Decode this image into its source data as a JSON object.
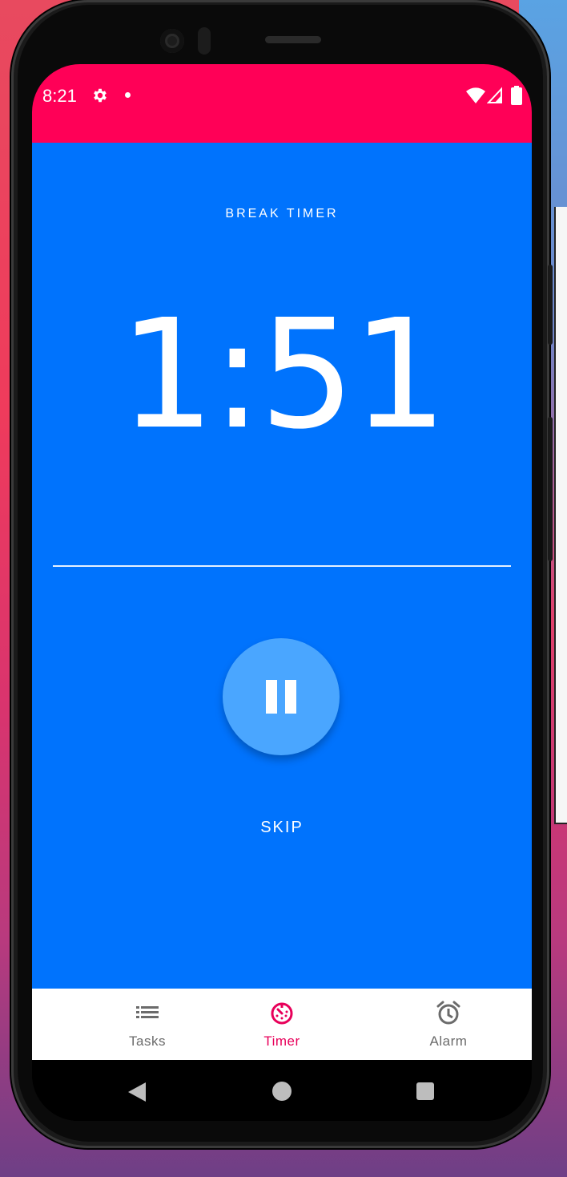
{
  "status_bar": {
    "time": "8:21",
    "icons": [
      "gear-icon",
      "notification-dot-icon",
      "wifi-icon",
      "signal-icon",
      "battery-icon"
    ],
    "color": "#ff0057"
  },
  "timer": {
    "label": "BREAK TIMER",
    "value": "1:51",
    "background": "#0073fd"
  },
  "controls": {
    "pause_icon": "pause-icon",
    "skip_label": "SKIP",
    "fab_color": "#4aa6ff"
  },
  "bottom_nav": {
    "active": "Timer",
    "active_color": "#e8005a",
    "items": [
      {
        "label": "Tasks",
        "icon": "list-icon"
      },
      {
        "label": "Timer",
        "icon": "timer-icon"
      },
      {
        "label": "Alarm",
        "icon": "alarm-clock-icon"
      }
    ]
  },
  "system_nav": {
    "icons": [
      "back-icon",
      "home-icon",
      "recents-icon"
    ]
  }
}
